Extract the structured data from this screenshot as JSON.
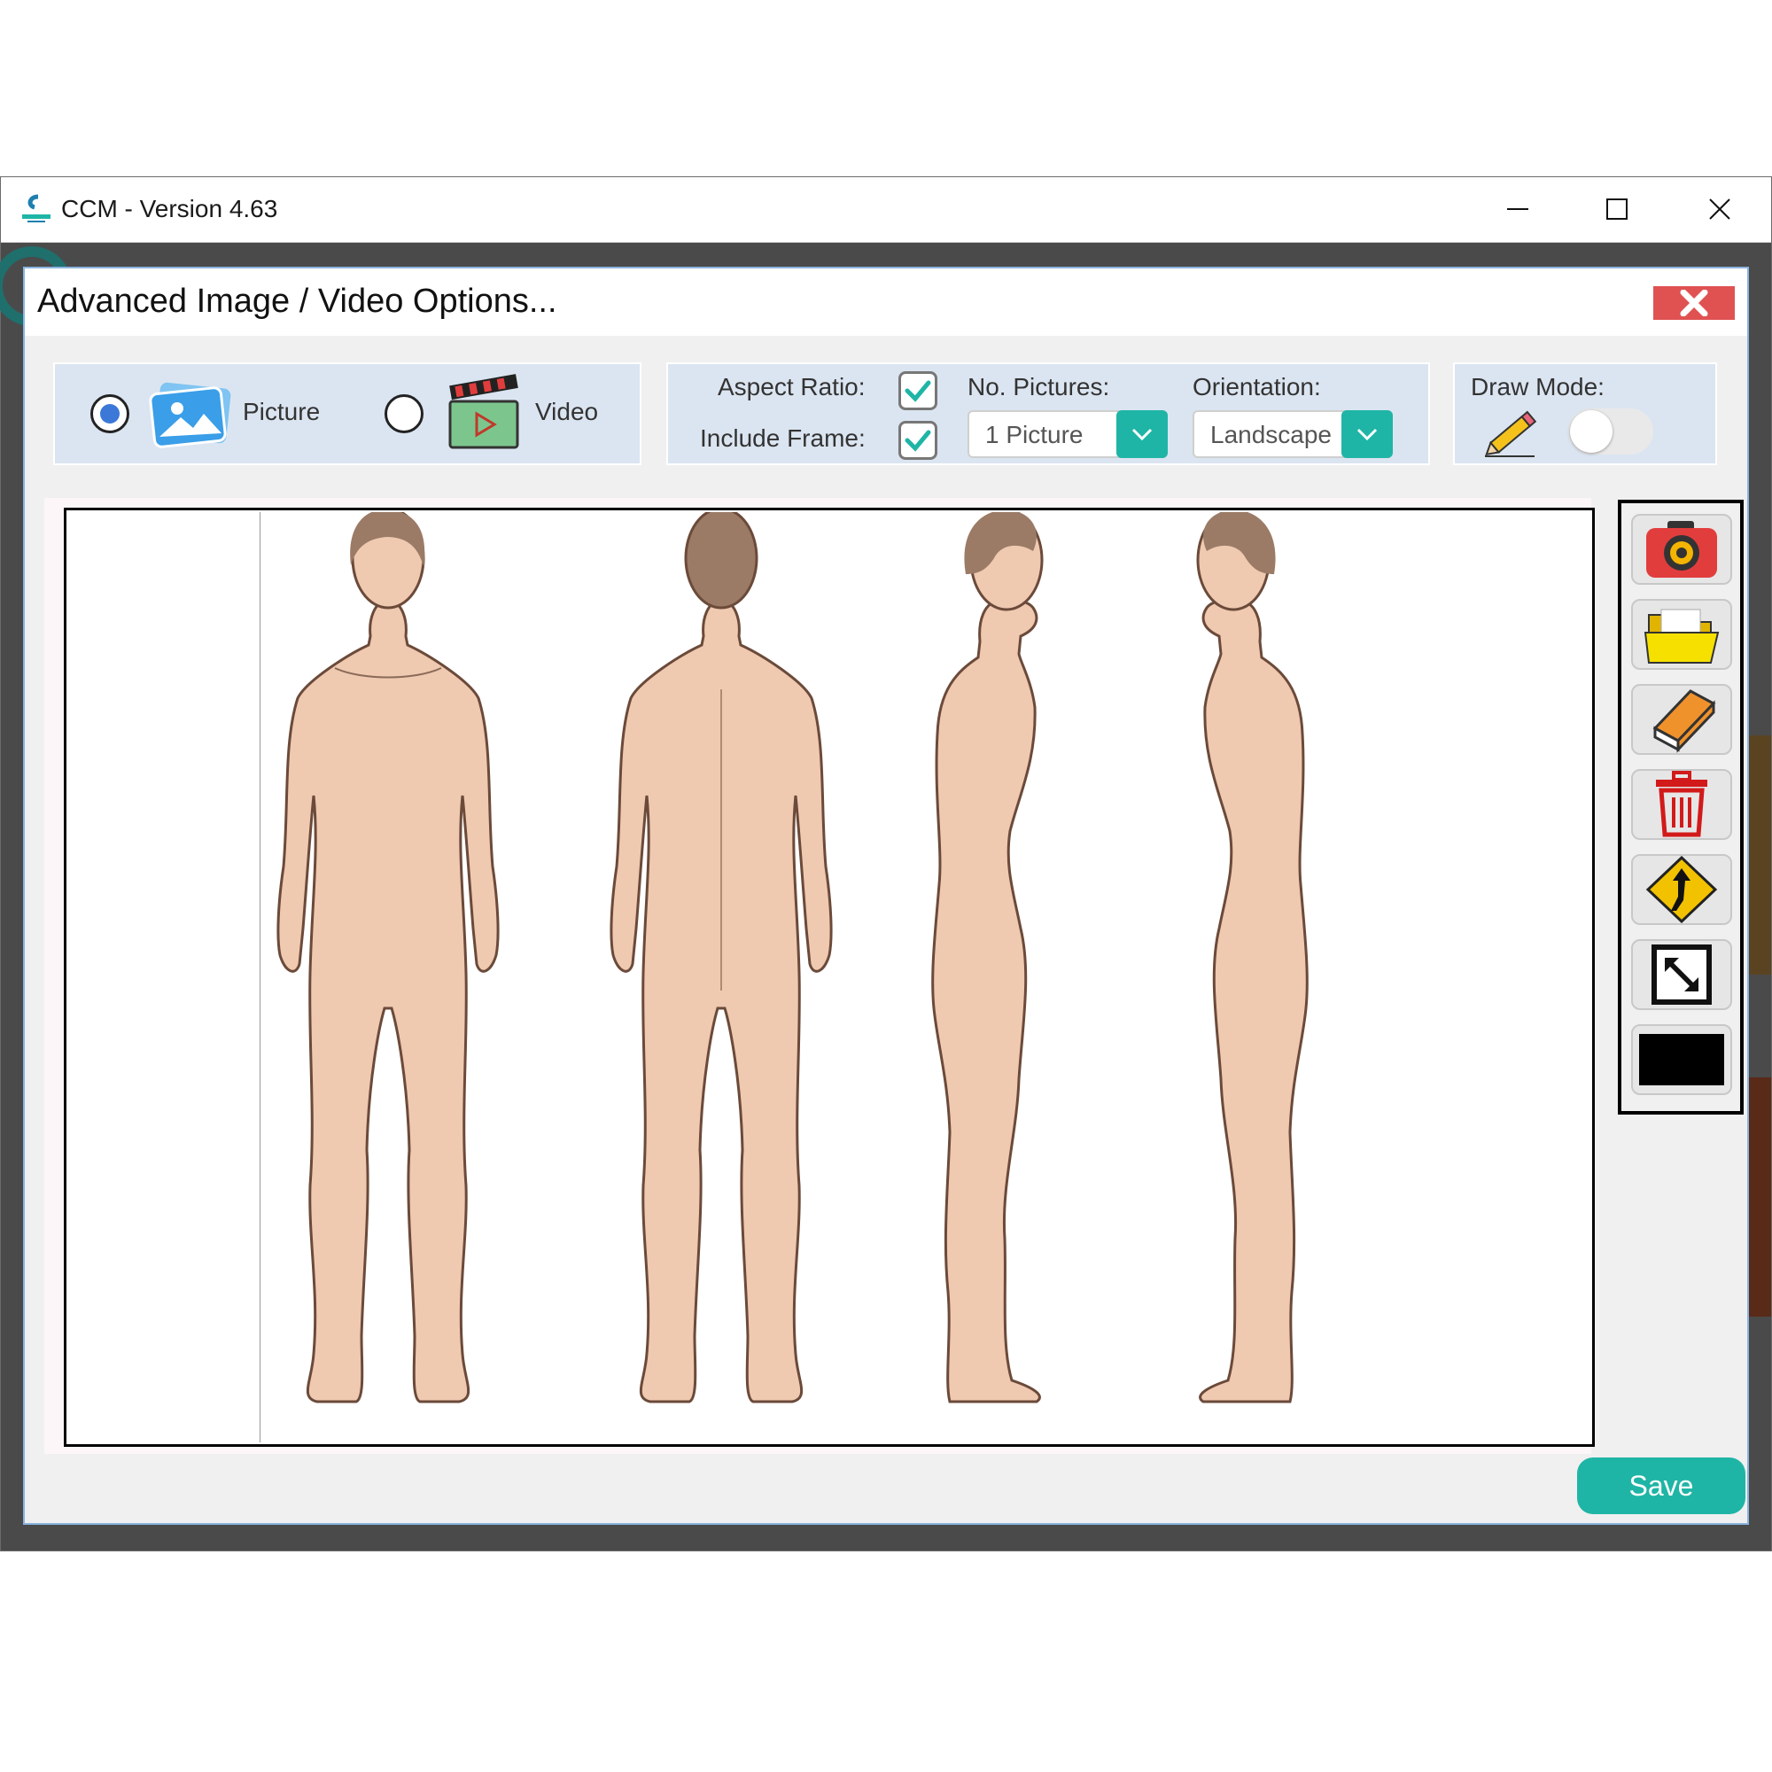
{
  "window": {
    "title": "CCM - Version 4.63"
  },
  "dialog": {
    "title": "Advanced Image / Video Options...",
    "media_type": {
      "options": [
        {
          "label": "Picture",
          "selected": true
        },
        {
          "label": "Video",
          "selected": false
        }
      ]
    },
    "settings": {
      "aspect_ratio_label": "Aspect Ratio:",
      "aspect_ratio_checked": true,
      "include_frame_label": "Include Frame:",
      "include_frame_checked": true,
      "no_pictures_label": "No. Pictures:",
      "no_pictures_value": "1 Picture",
      "orientation_label": "Orientation:",
      "orientation_value": "Landscape"
    },
    "draw_mode": {
      "label": "Draw Mode:",
      "enabled": false
    },
    "toolbar": {
      "tools": [
        "camera-icon",
        "folder-icon",
        "book-icon",
        "trash-icon",
        "merge-arrow-icon",
        "resize-icon",
        "color-swatch"
      ],
      "swatch_color": "#000000"
    },
    "save_label": "Save"
  },
  "colors": {
    "accent": "#1fb5a6",
    "close": "#e05252",
    "panel": "#dbe5f1",
    "skin": "#efc9b0",
    "hair": "#9b7b66"
  }
}
